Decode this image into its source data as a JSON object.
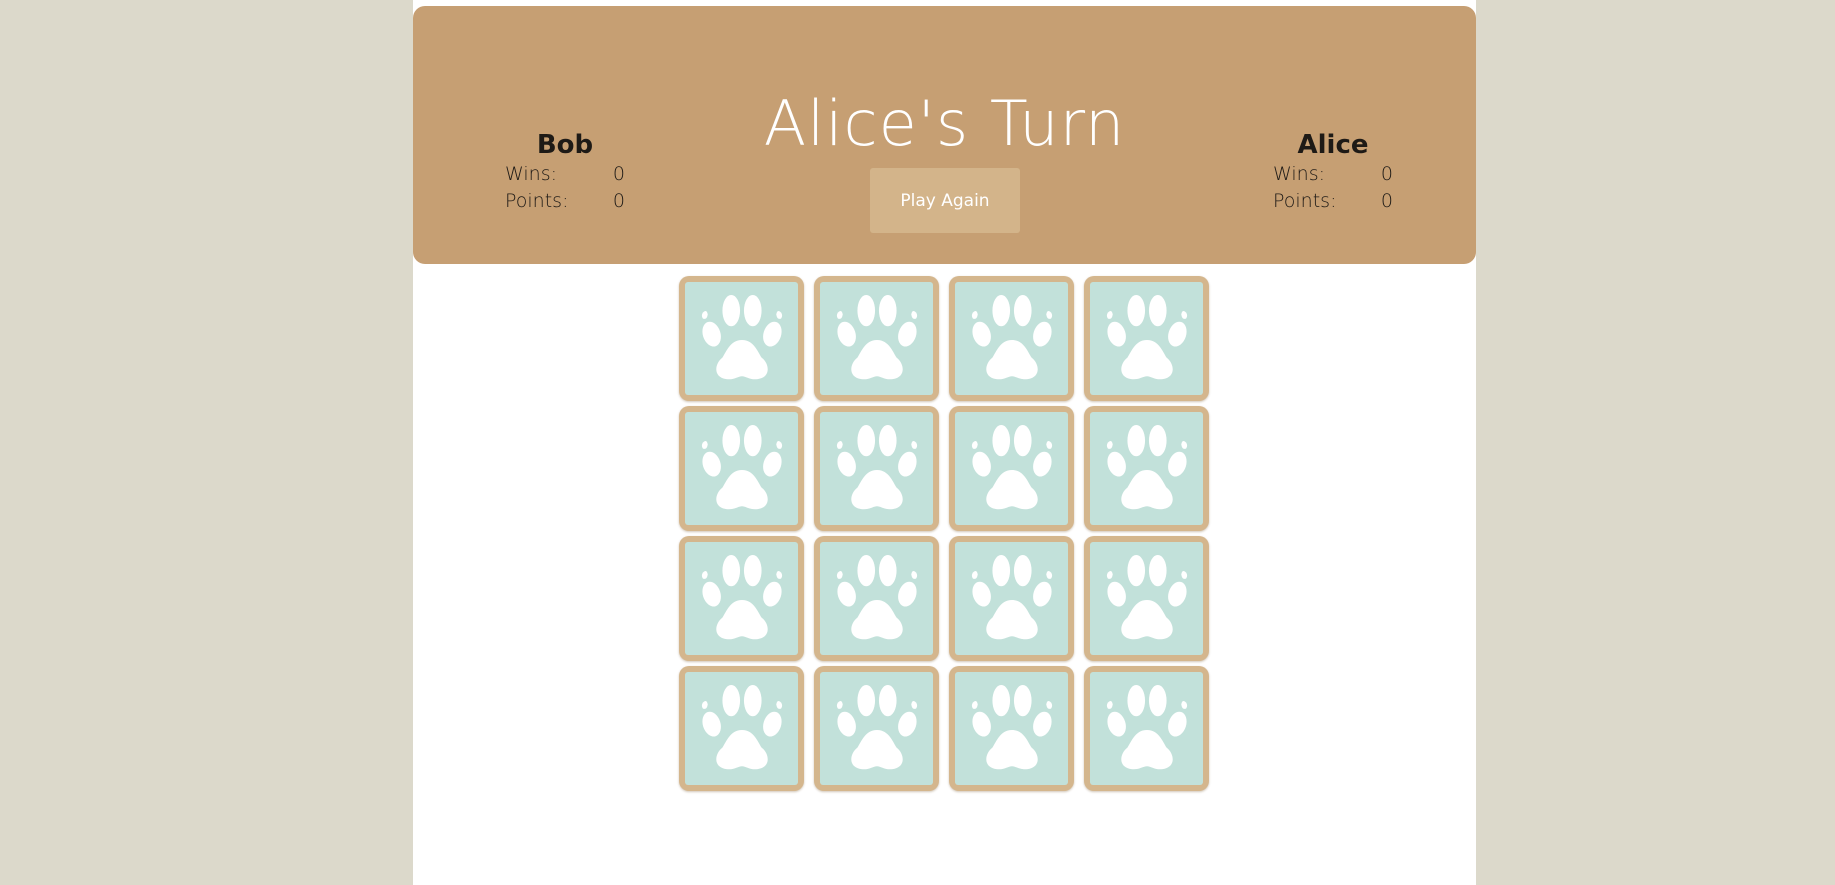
{
  "header": {
    "turn_title": "Alice's Turn",
    "play_again_label": "Play Again"
  },
  "players": {
    "left": {
      "name": "Bob",
      "wins_label": "Wins:",
      "wins": "0",
      "points_label": "Points:",
      "points": "0"
    },
    "right": {
      "name": "Alice",
      "wins_label": "Wins:",
      "wins": "0",
      "points_label": "Points:",
      "points": "0"
    }
  },
  "board": {
    "rows": 4,
    "columns": 4,
    "card_back_icon": "paw-icon",
    "card_count": 16
  },
  "colors": {
    "background": "#dcd9cb",
    "header": "#c69f73",
    "button": "#d3b48a",
    "card_border": "#d4b68d",
    "card_face": "#c2e1da",
    "paw": "#ffffff"
  }
}
